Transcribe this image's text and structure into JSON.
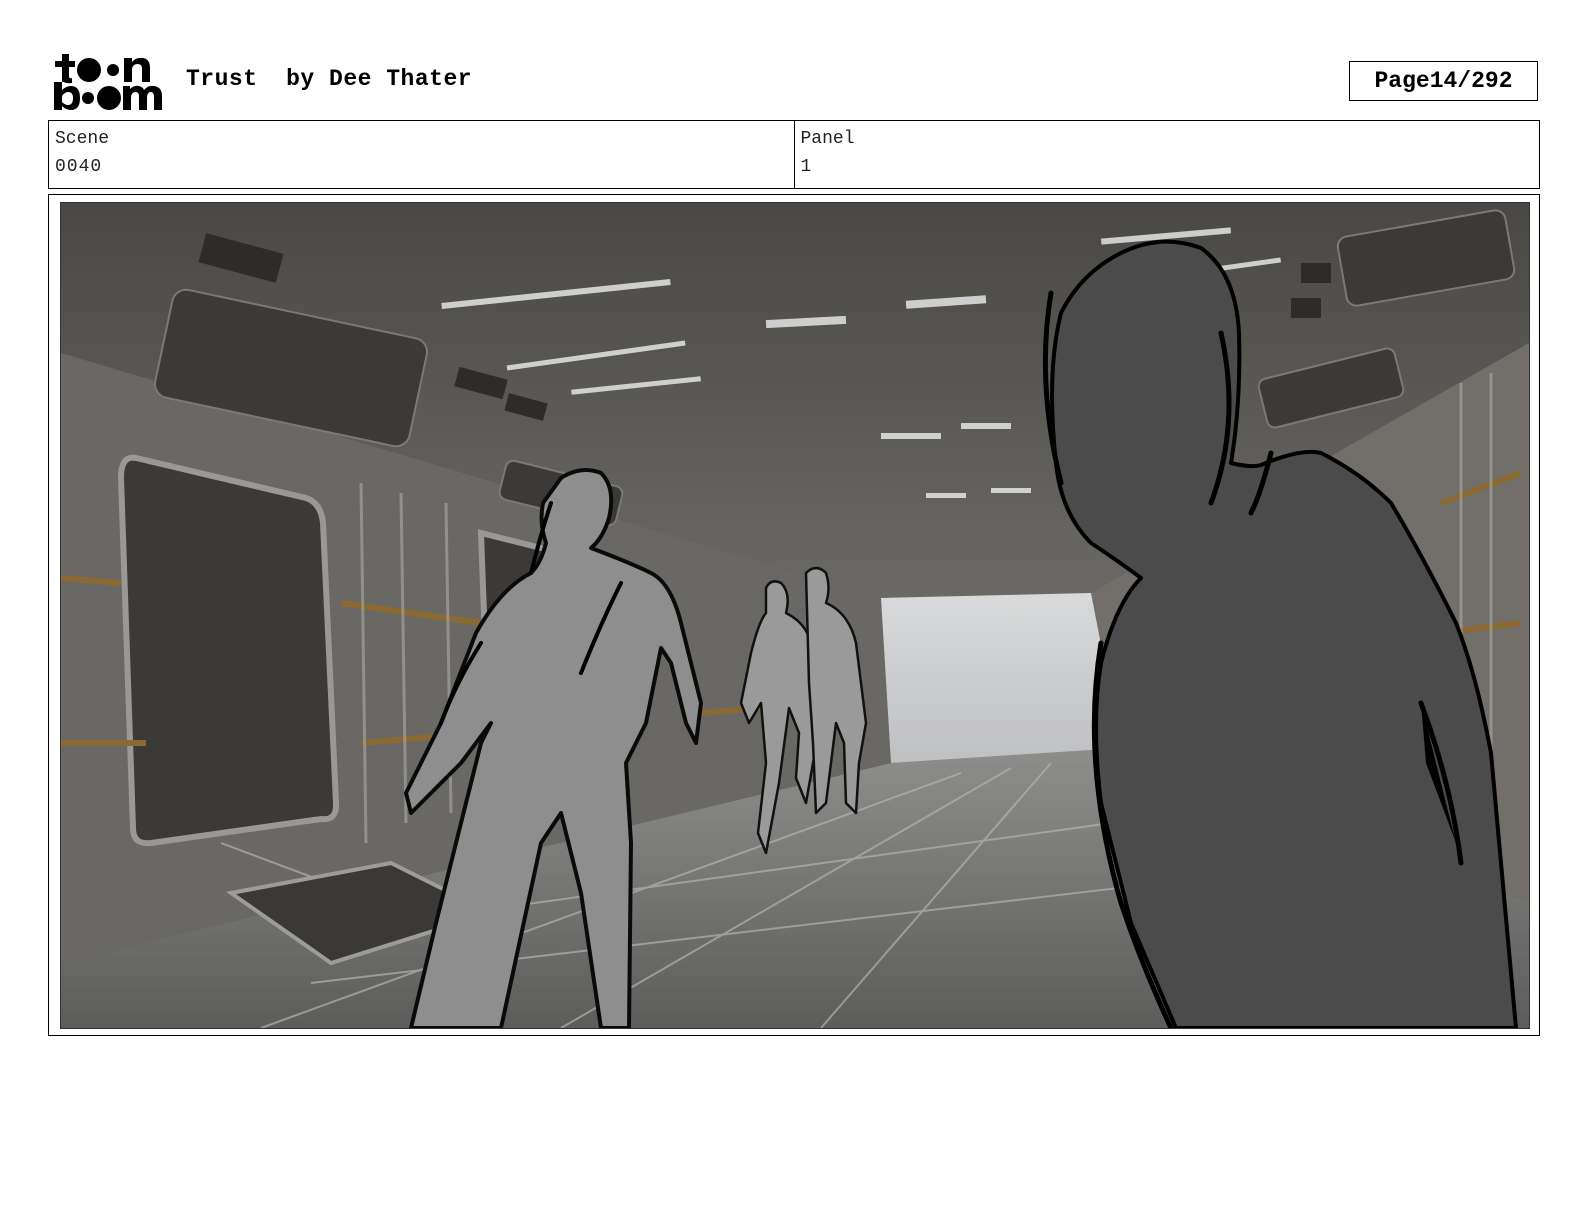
{
  "header": {
    "logo_text": "toon boom",
    "title": "Trust",
    "author": "by Dee Thater",
    "page_label": "Page",
    "page_number": "14/292"
  },
  "meta": {
    "scene_label": "Scene",
    "scene_value": "0040",
    "panel_label": "Panel",
    "panel_value": "1"
  }
}
